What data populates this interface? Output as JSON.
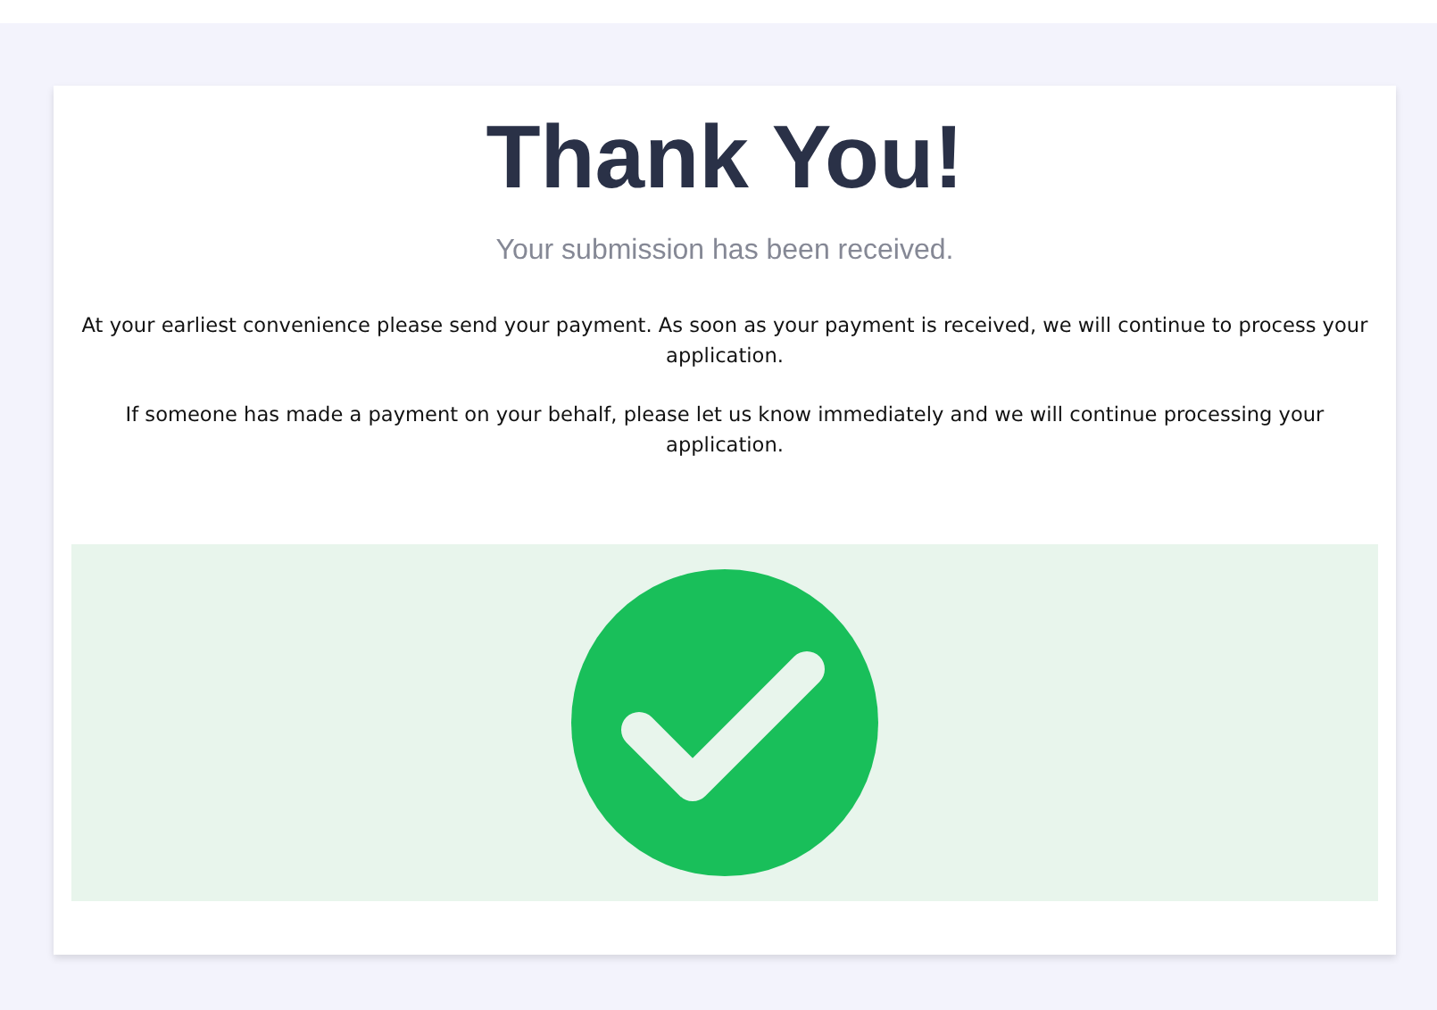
{
  "title": "Thank You!",
  "subtitle": "Your submission has been received.",
  "paragraphs": [
    "At your earliest convenience please send your payment. As soon as your payment is received, we will continue to process your application.",
    "If someone has made a payment on your behalf, please let us know immediately and we will continue processing your application."
  ]
}
